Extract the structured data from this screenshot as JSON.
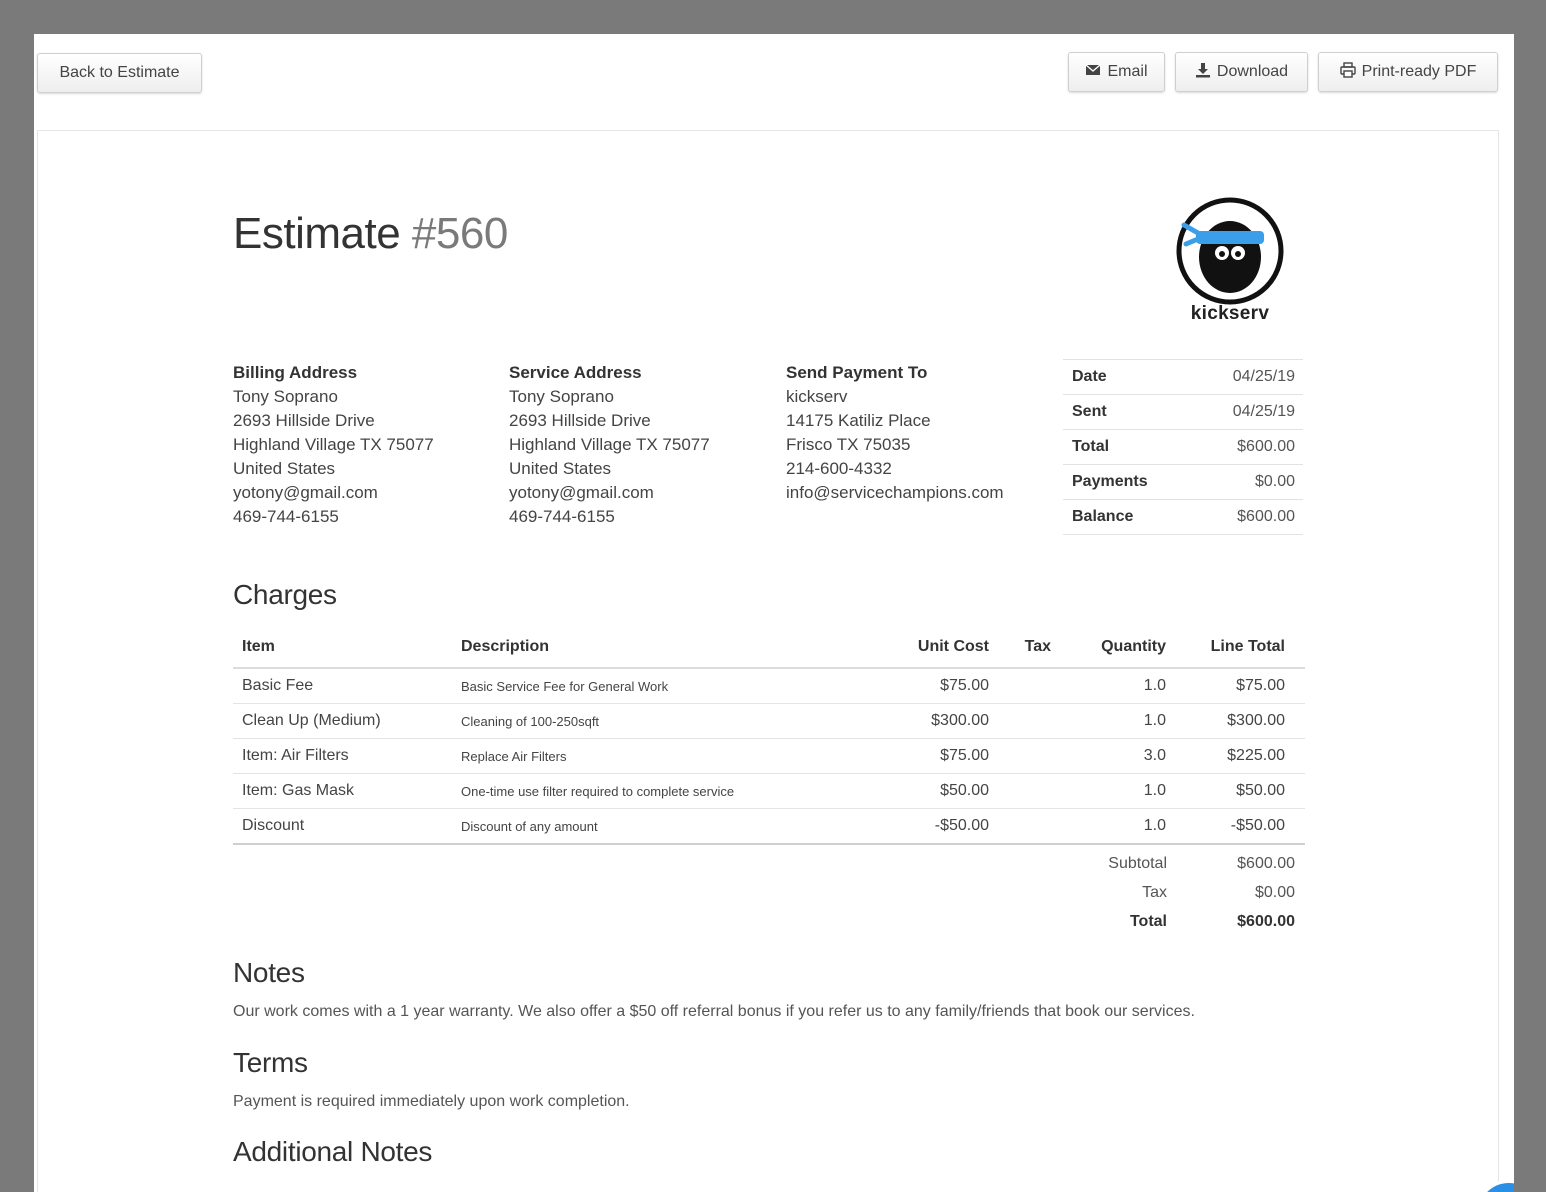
{
  "toolbar": {
    "back_label": "Back to Estimate",
    "email_label": "Email",
    "download_label": "Download",
    "print_label": "Print-ready PDF"
  },
  "estimate": {
    "title_word": "Estimate",
    "number": "#560"
  },
  "logo": {
    "word": "kickserv",
    "headband_color": "#3b9ee8"
  },
  "billing": {
    "heading": "Billing Address",
    "lines": [
      "Tony Soprano",
      "2693 Hillside Drive",
      "Highland Village TX 75077",
      "United States",
      "yotony@gmail.com",
      "469-744-6155"
    ]
  },
  "service": {
    "heading": "Service Address",
    "lines": [
      "Tony Soprano",
      "2693 Hillside Drive",
      "Highland Village TX 75077",
      "United States",
      "yotony@gmail.com",
      "469-744-6155"
    ]
  },
  "payto": {
    "heading": "Send Payment To",
    "lines": [
      "kickserv",
      "14175 Katiliz Place",
      "Frisco TX 75035",
      "214-600-4332",
      "info@servicechampions.com"
    ]
  },
  "summary": [
    {
      "label": "Date",
      "value": "04/25/19"
    },
    {
      "label": "Sent",
      "value": "04/25/19"
    },
    {
      "label": "Total",
      "value": "$600.00"
    },
    {
      "label": "Payments",
      "value": "$0.00"
    },
    {
      "label": "Balance",
      "value": "$600.00"
    }
  ],
  "charges": {
    "heading": "Charges",
    "columns": {
      "item": "Item",
      "description": "Description",
      "unit_cost": "Unit Cost",
      "tax": "Tax",
      "quantity": "Quantity",
      "line_total": "Line Total"
    },
    "rows": [
      {
        "item": "Basic Fee",
        "description": "Basic Service Fee for General Work",
        "unit_cost": "$75.00",
        "tax": "",
        "quantity": "1.0",
        "line_total": "$75.00"
      },
      {
        "item": "Clean Up (Medium)",
        "description": "Cleaning of 100-250sqft",
        "unit_cost": "$300.00",
        "tax": "",
        "quantity": "1.0",
        "line_total": "$300.00"
      },
      {
        "item": "Item: Air Filters",
        "description": "Replace Air Filters",
        "unit_cost": "$75.00",
        "tax": "",
        "quantity": "3.0",
        "line_total": "$225.00"
      },
      {
        "item": "Item: Gas Mask",
        "description": "One-time use filter required to complete service",
        "unit_cost": "$50.00",
        "tax": "",
        "quantity": "1.0",
        "line_total": "$50.00"
      },
      {
        "item": "Discount",
        "description": "Discount of any amount",
        "unit_cost": "-$50.00",
        "tax": "",
        "quantity": "1.0",
        "line_total": "-$50.00"
      }
    ],
    "subtotal_label": "Subtotal",
    "subtotal": "$600.00",
    "tax_label": "Tax",
    "tax": "$0.00",
    "total_label": "Total",
    "total": "$600.00"
  },
  "notes": {
    "heading": "Notes",
    "text": "Our work comes with a 1 year warranty. We also offer a $50 off referral bonus if you refer us to any family/friends that book our services."
  },
  "terms": {
    "heading": "Terms",
    "text": "Payment is required immediately upon work completion."
  },
  "additional_notes": {
    "heading": "Additional Notes"
  },
  "chat": {
    "icon": "chat-bubble-icon",
    "color": "#2b8fe6"
  }
}
